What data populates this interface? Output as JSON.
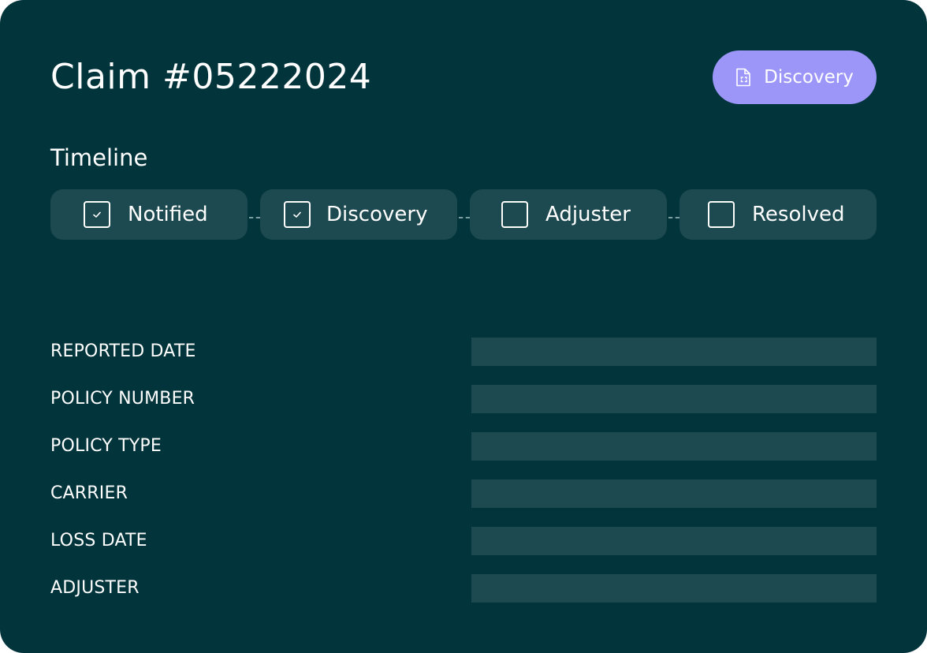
{
  "claim": {
    "title": "Claim #05222024",
    "status_label": "Discovery",
    "status_icon": "document-scan-icon",
    "status_color": "#9b96f8"
  },
  "timeline": {
    "heading": "Timeline",
    "steps": [
      {
        "label": "Notified",
        "checked": true
      },
      {
        "label": "Discovery",
        "checked": true
      },
      {
        "label": "Adjuster",
        "checked": false
      },
      {
        "label": "Resolved",
        "checked": false
      }
    ]
  },
  "fields": [
    {
      "label": "REPORTED DATE",
      "value": ""
    },
    {
      "label": "POLICY NUMBER",
      "value": ""
    },
    {
      "label": "POLICY TYPE",
      "value": ""
    },
    {
      "label": "CARRIER",
      "value": ""
    },
    {
      "label": "LOSS DATE",
      "value": ""
    },
    {
      "label": "ADJUSTER",
      "value": ""
    }
  ],
  "colors": {
    "background": "#02343b",
    "panel": "#1d4a50",
    "accent": "#9b96f8",
    "text": "#ffffff"
  }
}
